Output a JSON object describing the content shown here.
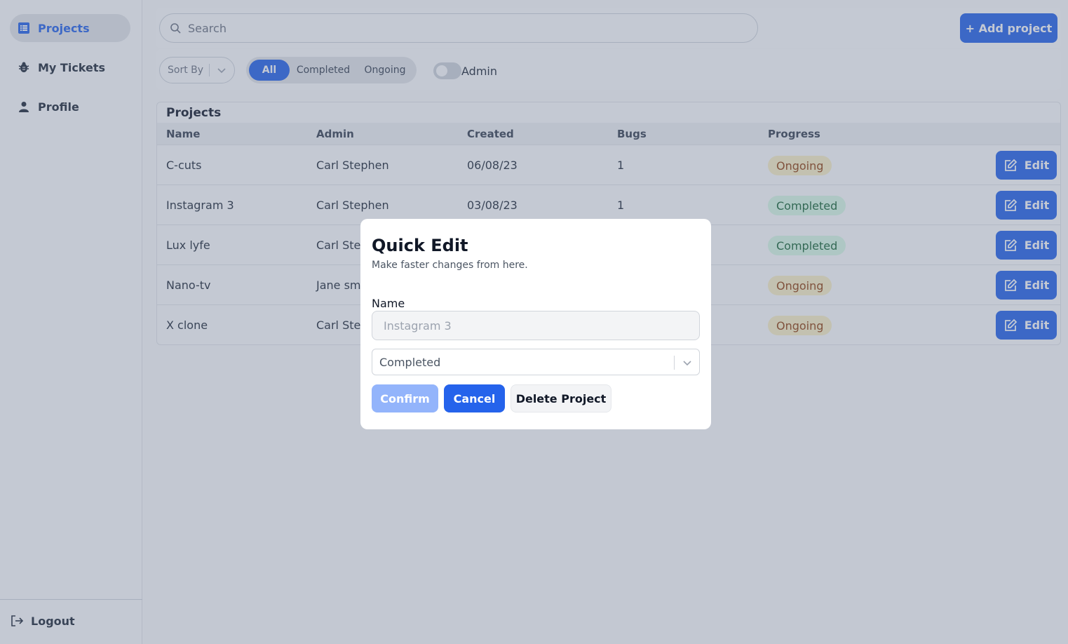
{
  "sidebar": {
    "items": [
      {
        "label": "Projects",
        "icon": "list-icon",
        "active": true
      },
      {
        "label": "My Tickets",
        "icon": "bug-icon",
        "active": false
      },
      {
        "label": "Profile",
        "icon": "user-icon",
        "active": false
      }
    ],
    "logout_label": "Logout"
  },
  "topbar": {
    "search_placeholder": "Search",
    "add_button_label": "+ Add project"
  },
  "filters": {
    "sort_placeholder": "Sort By",
    "segments": [
      "All",
      "Completed",
      "Ongoing"
    ],
    "active_segment": "All",
    "admin_toggle_label": "Admin",
    "admin_toggle_on": false
  },
  "table": {
    "title": "Projects",
    "headers": [
      "Name",
      "Admin",
      "Created",
      "Bugs",
      "Progress"
    ],
    "rows": [
      {
        "name": "C-cuts",
        "admin": "Carl Stephen",
        "created": "06/08/23",
        "bugs": "1",
        "progress": "Ongoing"
      },
      {
        "name": "Instagram 3",
        "admin": "Carl Stephen",
        "created": "03/08/23",
        "bugs": "1",
        "progress": "Completed"
      },
      {
        "name": "Lux lyfe",
        "admin": "Carl Step",
        "created": "",
        "bugs": "",
        "progress": "Completed"
      },
      {
        "name": "Nano-tv",
        "admin": "Jane sm",
        "created": "",
        "bugs": "",
        "progress": "Ongoing"
      },
      {
        "name": "X clone",
        "admin": "Carl Step",
        "created": "",
        "bugs": "",
        "progress": "Ongoing"
      }
    ],
    "edit_label": "Edit"
  },
  "modal": {
    "title": "Quick Edit",
    "subtitle": "Make faster changes from here.",
    "name_label": "Name",
    "name_placeholder": "Instagram 3",
    "status_value": "Completed",
    "confirm_label": "Confirm",
    "cancel_label": "Cancel",
    "delete_label": "Delete Project"
  },
  "colors": {
    "accent": "#2563eb",
    "ongoing_bg": "#fef3c7",
    "completed_bg": "#dcfce7"
  }
}
